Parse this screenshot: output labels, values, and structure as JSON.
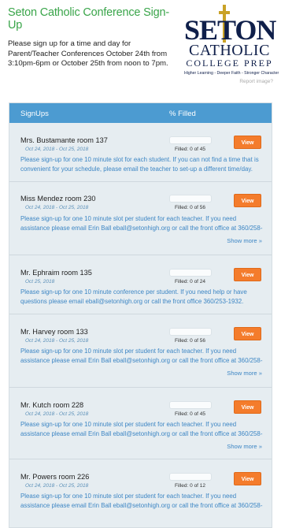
{
  "header": {
    "title": "Seton Catholic Conference Sign-Up",
    "intro": "Please sign up for a time and day for Parent/Teacher Conferences October 24th from 3:10pm-6pm or October 25th from noon to 7pm.",
    "report_link": "Report image?"
  },
  "logo": {
    "word1": "SETON",
    "word2": "CATHOLIC",
    "word3": "COLLEGE PREP",
    "motto": "Higher Learning - Deeper Faith - Stronger Character"
  },
  "colors": {
    "accent_blue": "#4c9bd1",
    "view_orange": "#f47c2c",
    "title_green": "#3aa54a"
  },
  "table": {
    "col_signups": "SignUps",
    "col_filled": "% Filled"
  },
  "rows": [
    {
      "name": "Mrs. Bustamante room 137",
      "date": "Oct 24, 2018 - Oct 25, 2018",
      "filled": "Filled: 0 of 45",
      "filled_fraction": 0,
      "button": "View",
      "desc": "Please sign-up for one 10 minute slot for each student. If you can not find a time that is convenient for your schedule, please email the teacher to set-up a different time/day.",
      "show_more": ""
    },
    {
      "name": "Miss Mendez room 230",
      "date": "Oct 24, 2018 - Oct 25, 2018",
      "filled": "Filled: 0 of 56",
      "filled_fraction": 0,
      "button": "View",
      "desc": "Please sign-up for one 10 minute slot per student for each teacher. If you need assistance please email Erin Ball eball@setonhigh.org or call the front office at 360/258-",
      "show_more": "Show more »"
    },
    {
      "name": "Mr. Ephraim room 135",
      "date": "Oct 25, 2018",
      "filled": "Filled: 0 of 24",
      "filled_fraction": 0,
      "button": "View",
      "desc": "Please sign-up for one 10 minute conference per student. If you need help or have questions please email eball@setonhigh.org or call the front office 360/253-1932.",
      "show_more": ""
    },
    {
      "name": "Mr. Harvey room 133",
      "date": "Oct 24, 2018 - Oct 25, 2018",
      "filled": "Filled: 0 of 56",
      "filled_fraction": 0,
      "button": "View",
      "desc": "Please sign-up for one 10 minute slot per student for each teacher. If you need assistance please email Erin Ball eball@setonhigh.org or call the front office at 360/258-",
      "show_more": "Show more »"
    },
    {
      "name": "Mr. Kutch room 228",
      "date": "Oct 24, 2018 - Oct 25, 2018",
      "filled": "Filled: 0 of 45",
      "filled_fraction": 0,
      "button": "View",
      "desc": "Please sign-up for one 10 minute slot per student for each teacher. If you need assistance please email Erin Ball eball@setonhigh.org or call the front office at 360/258-",
      "show_more": "Show more »"
    },
    {
      "name": "Mr. Powers room 226",
      "date": "Oct 24, 2018 - Oct 25, 2018",
      "filled": "Filled: 0 of 12",
      "filled_fraction": 0,
      "button": "View",
      "desc": "Please sign-up for one 10 minute slot per student for each teacher. If you need assistance please email Erin Ball eball@setonhigh.org or call the front office at 360/258-",
      "show_more": ""
    }
  ]
}
